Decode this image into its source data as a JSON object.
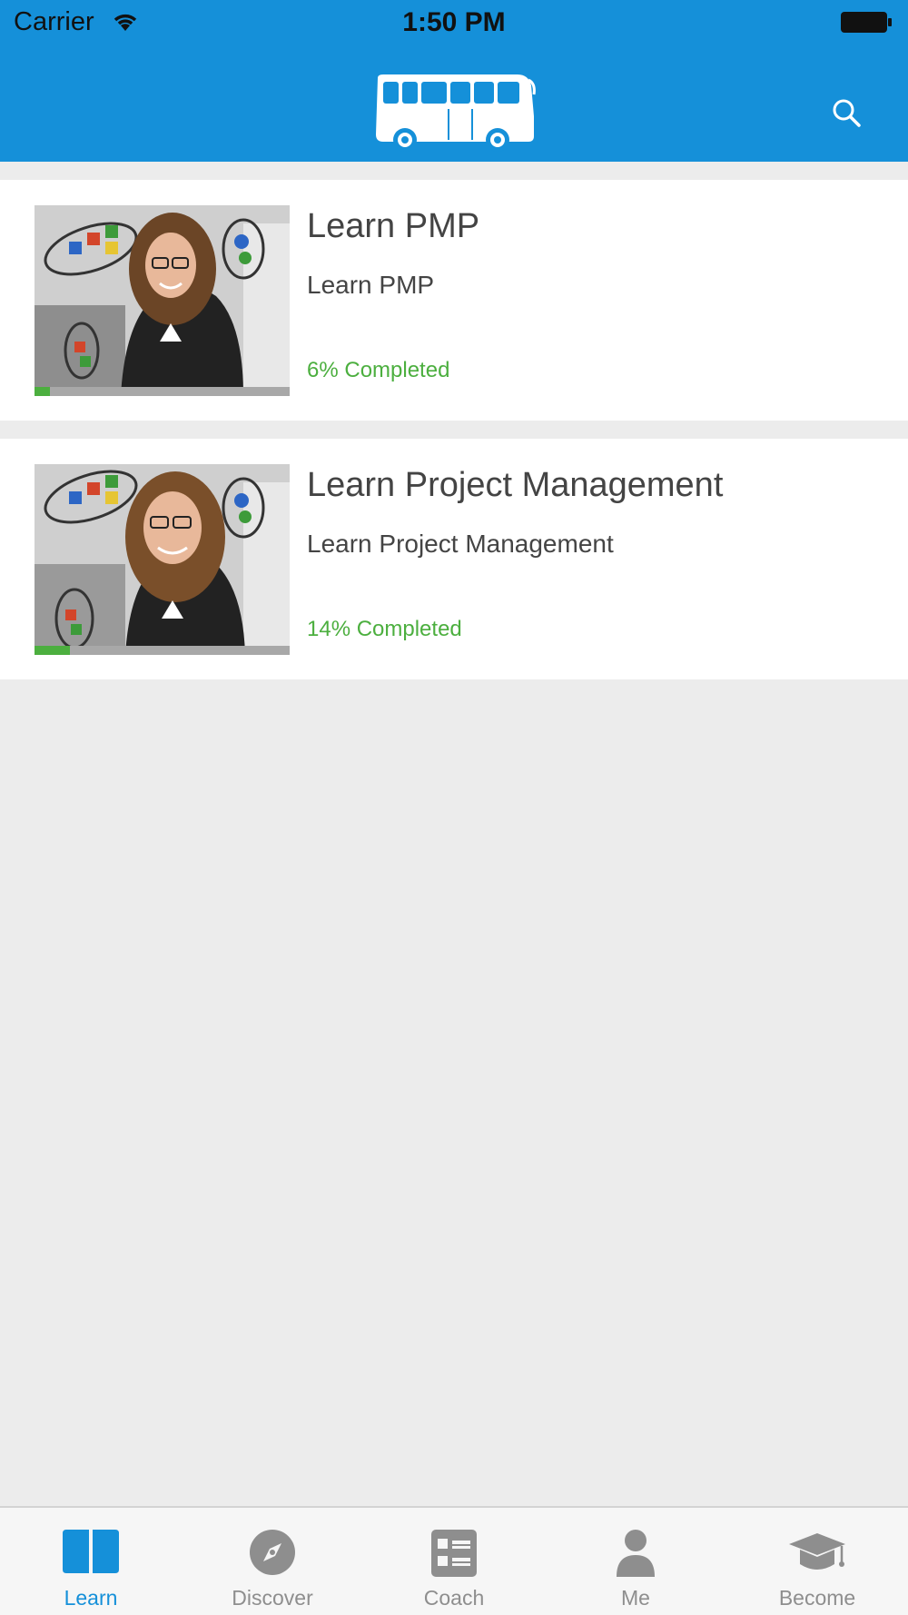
{
  "status_bar": {
    "carrier": "Carrier",
    "time": "1:50 PM"
  },
  "header": {
    "logo_icon": "bus-icon",
    "search_icon": "search-icon"
  },
  "courses": [
    {
      "title": "Learn PMP",
      "subtitle": "Learn PMP",
      "progress_text": "6% Completed",
      "progress": 0.06
    },
    {
      "title": "Learn Project Management",
      "subtitle": "Learn Project Management",
      "progress_text": "14% Completed",
      "progress": 0.14
    }
  ],
  "tabs": [
    {
      "label": "Learn",
      "icon": "book-icon",
      "active": true
    },
    {
      "label": "Discover",
      "icon": "compass-icon",
      "active": false
    },
    {
      "label": "Coach",
      "icon": "list-icon",
      "active": false
    },
    {
      "label": "Me",
      "icon": "person-icon",
      "active": false
    },
    {
      "label": "Become",
      "icon": "graduation-cap-icon",
      "active": false
    }
  ],
  "colors": {
    "brand": "#1590d9",
    "progress": "#4caf3f",
    "background": "#ececec"
  }
}
